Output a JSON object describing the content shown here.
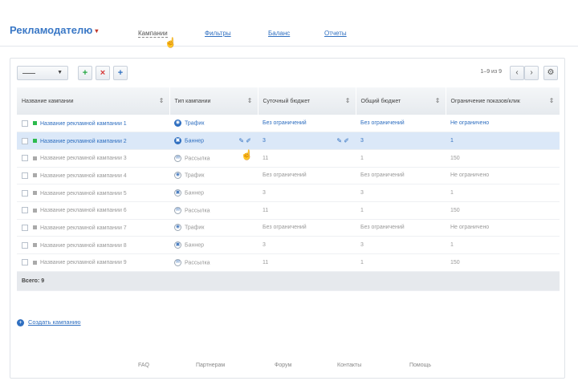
{
  "nav": {
    "brand": "Рекламодателю",
    "links": [
      "Кампании",
      "Фильтры",
      "Баланс",
      "Отчеты"
    ]
  },
  "toolbar": {
    "add_icon": "plus-green",
    "delete_icon": "cross-red",
    "more_icon": "plus-blue"
  },
  "pager": {
    "info": "1–9 из 9",
    "prev": "‹",
    "next": "›",
    "settings": "⚙"
  },
  "table": {
    "columns": [
      "Название кампании",
      "Тип кампании",
      "Суточный бюджет",
      "Общий бюджет",
      "Ограничение показов/клик"
    ],
    "rows": [
      {
        "name": "Название рекламной кампании 1",
        "type": "Трафик",
        "daily": "Без ограничений",
        "total": "Без ограничений",
        "limit": "Не ограничено",
        "state": "active"
      },
      {
        "name": "Название рекламной кампании 2",
        "type": "Баннер",
        "daily": "3",
        "total": "3",
        "limit": "1",
        "state": "selected"
      },
      {
        "name": "Название рекламной кампании 3",
        "type": "Рассылка",
        "daily": "11",
        "total": "1",
        "limit": "150",
        "state": "off"
      },
      {
        "name": "Название рекламной кампании 4",
        "type": "Трафик",
        "daily": "Без ограничений",
        "total": "Без ограничений",
        "limit": "Не ограничено",
        "state": "off"
      },
      {
        "name": "Название рекламной кампании 5",
        "type": "Баннер",
        "daily": "3",
        "total": "3",
        "limit": "1",
        "state": "off"
      },
      {
        "name": "Название рекламной кампании 6",
        "type": "Рассылка",
        "daily": "11",
        "total": "1",
        "limit": "150",
        "state": "off"
      },
      {
        "name": "Название рекламной кампании 7",
        "type": "Трафик",
        "daily": "Без ограничений",
        "total": "Без ограничений",
        "limit": "Не ограничено",
        "state": "off"
      },
      {
        "name": "Название рекламной кампании 8",
        "type": "Баннер",
        "daily": "3",
        "total": "3",
        "limit": "1",
        "state": "off"
      },
      {
        "name": "Название рекламной кампании 9",
        "type": "Рассылка",
        "daily": "11",
        "total": "1",
        "limit": "150",
        "state": "off"
      }
    ],
    "total_label": "Всего: 9"
  },
  "add_link": "Создать кампанию",
  "footer": [
    "FAQ",
    "Партнерам",
    "Форум",
    "Контакты",
    "Помощь"
  ],
  "colors": {
    "accent": "#2f6fc0",
    "active_dot": "#2dbb4e",
    "selected_row": "#dbe8f8"
  }
}
